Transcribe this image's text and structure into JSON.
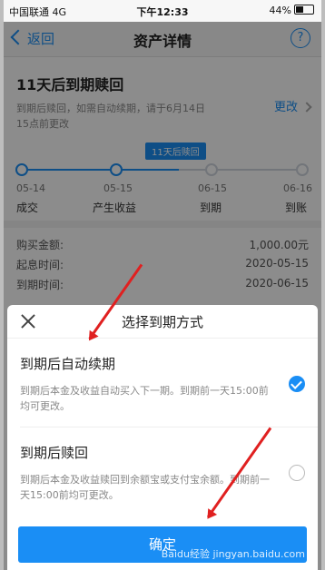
{
  "status_bar": {
    "carrier": "中国联通",
    "network": "4G",
    "time": "下午12:33",
    "battery": "44%"
  },
  "nav": {
    "back_label": "返回",
    "title": "资产详情",
    "help": "?"
  },
  "card": {
    "title": "11天后到期赎回",
    "description": "到期后赎回，如需自动续期，请于6月14日15点前更改",
    "change_label": "更改",
    "timeline_tip": "11天后赎回",
    "timeline": [
      {
        "date": "05-14",
        "label": "成交"
      },
      {
        "date": "05-15",
        "label": "产生收益"
      },
      {
        "date": "06-15",
        "label": "到期"
      },
      {
        "date": "06-16",
        "label": "到账"
      }
    ]
  },
  "details": [
    {
      "key": "购买金额:",
      "value": "1,000.00元"
    },
    {
      "key": "起息时间:",
      "value": "2020-05-15"
    },
    {
      "key": "到期时间:",
      "value": "2020-06-15"
    }
  ],
  "sheet": {
    "title": "选择到期方式",
    "options": [
      {
        "title": "到期后自动续期",
        "desc": "到期后本金及收益自动买入下一期。到期前一天15:00前均可更改。",
        "selected": true
      },
      {
        "title": "到期后赎回",
        "desc": "到期后本金及收益赎回到余额宝或支付宝余额。到期前一天15:00前均可更改。",
        "selected": false
      }
    ],
    "confirm_label": "确定"
  },
  "watermark": "Baidu经验 jingyan.baidu.com"
}
